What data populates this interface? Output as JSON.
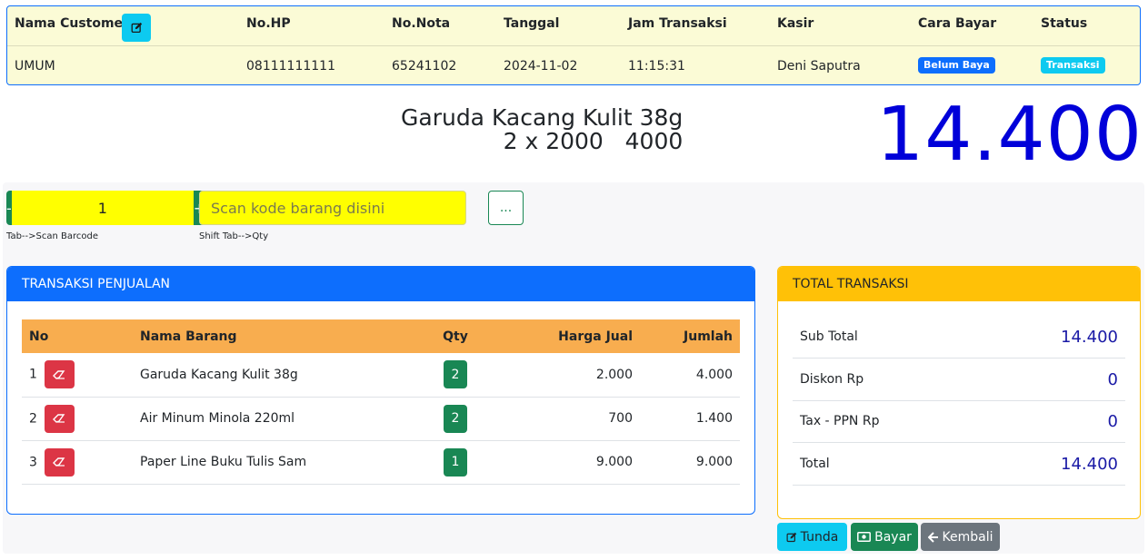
{
  "header": {
    "columns": {
      "customer": "Nama Customer",
      "hp": "No.HP",
      "nota": "No.Nota",
      "tanggal": "Tanggal",
      "jam": "Jam Transaksi",
      "kasir": "Kasir",
      "cara_bayar": "Cara Bayar",
      "status": "Status"
    },
    "values": {
      "customer": "UMUM",
      "hp": "08111111111",
      "nota": "65241102",
      "tanggal": "2024-11-02",
      "jam": "11:15:31",
      "kasir": "Deni Saputra",
      "cara_bayar": "Belum Baya",
      "status": "Transaksi"
    }
  },
  "display": {
    "last_item_name": "Garuda Kacang Kulit 38g",
    "last_item_calc": "2 x 2000   4000",
    "grand_total": "14.400"
  },
  "input": {
    "minus_label": "-",
    "plus_label": "+",
    "qty_value": "1",
    "scan_placeholder": "Scan kode barang disini",
    "more_label": "...",
    "qty_hint": "Tab-->Scan Barcode",
    "scan_hint": "Shift Tab-->Qty"
  },
  "sales": {
    "title": "TRANSAKSI PENJUALAN",
    "columns": [
      "No",
      "Nama Barang",
      "Qty",
      "Harga Jual",
      "Jumlah"
    ],
    "rows": [
      {
        "no": "1",
        "name": "Garuda Kacang Kulit 38g",
        "qty": "2",
        "price": "2.000",
        "amount": "4.000"
      },
      {
        "no": "2",
        "name": "Air Minum Minola 220ml",
        "qty": "2",
        "price": "700",
        "amount": "1.400"
      },
      {
        "no": "3",
        "name": "Paper Line Buku Tulis Sam",
        "qty": "1",
        "price": "9.000",
        "amount": "9.000"
      }
    ]
  },
  "totals": {
    "title": "TOTAL TRANSAKSI",
    "rows": [
      {
        "label": "Sub Total",
        "value": "14.400"
      },
      {
        "label": "Diskon Rp",
        "value": "0"
      },
      {
        "label": "Tax - PPN Rp",
        "value": "0"
      },
      {
        "label": "Total",
        "value": "14.400"
      }
    ]
  },
  "actions": {
    "tunda": "Tunda",
    "bayar": "Bayar",
    "kembali": "Kembali"
  },
  "colors": {
    "primary": "#0d6efd",
    "success": "#198754",
    "info": "#0dcaf0",
    "danger": "#dc3545",
    "warning": "#ffc107",
    "secondary": "#6c757d",
    "grand_total": "#0000d9"
  },
  "icons": {
    "edit": "pencil-square-icon",
    "delete": "eraser-icon",
    "money": "money-bill-icon",
    "back": "arrow-left-icon"
  }
}
